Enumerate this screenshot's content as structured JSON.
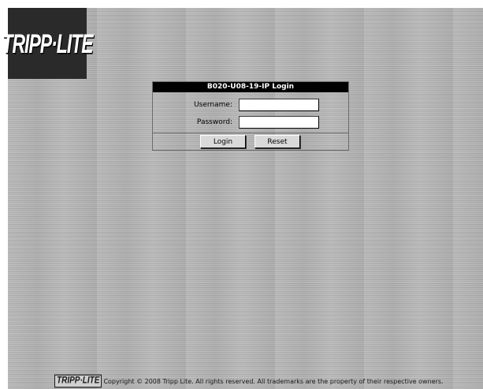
{
  "brand": {
    "logo_text": "TRIPP·LITE",
    "footer_logo_text": "TRIPP·LITE"
  },
  "login": {
    "title": "B020-U08-19-IP Login",
    "username_label": "Username:",
    "username_value": "",
    "password_label": "Password:",
    "password_value": "",
    "login_button": "Login",
    "reset_button": "Reset"
  },
  "footer": {
    "copyright": "Copyright © 2008 Tripp Lite. All rights reserved. All trademarks are the property of their respective owners."
  },
  "colors": {
    "background": "#b6b6b6",
    "title_bar": "#000000",
    "logo_box": "#2a2a2a"
  }
}
